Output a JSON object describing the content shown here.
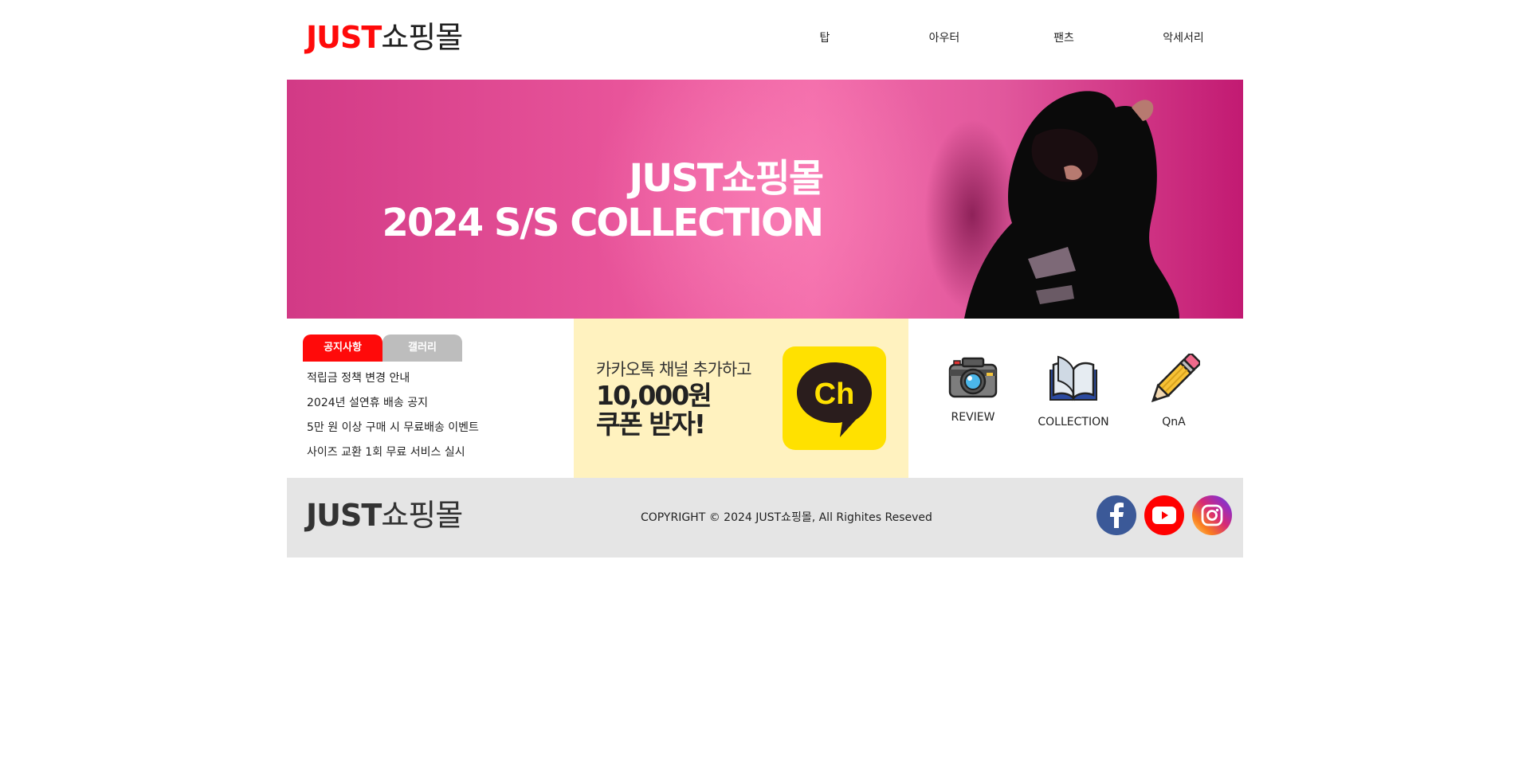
{
  "header": {
    "logo_en": "JUST",
    "logo_ko": "쇼핑몰",
    "nav": [
      "탑",
      "아우터",
      "팬츠",
      "악세서리"
    ]
  },
  "banner": {
    "title_line1": "JUST쇼핑몰",
    "title_line2": "2024 S/S COLLECTION",
    "background_color": "#e8549a"
  },
  "notice": {
    "tabs": [
      {
        "label": "공지사항",
        "active": true
      },
      {
        "label": "갤러리",
        "active": false
      }
    ],
    "items": [
      "적립금 정책 변경 안내",
      "2024년 설연휴 배송 공지",
      "5만 원 이상 구매 시 무료배송 이벤트",
      "사이즈 교환 1회 무료 서비스 실시"
    ]
  },
  "kakao": {
    "line1": "카카오톡 채널 추가하고",
    "line2": "10,000원",
    "line3": "쿠폰 받자!",
    "channel_icon_text": "Ch",
    "background_color": "#fff2bf",
    "icon_color": "#ffe100"
  },
  "quick_links": [
    {
      "label": "REVIEW",
      "icon": "camera-icon"
    },
    {
      "label": "COLLECTION",
      "icon": "book-icon"
    },
    {
      "label": "QnA",
      "icon": "pencil-icon"
    }
  ],
  "footer": {
    "logo_en": "JUST",
    "logo_ko": "쇼핑몰",
    "copyright": "COPYRIGHT © 2024 JUST쇼핑몰, All Righites Reseved",
    "social": [
      {
        "name": "facebook-icon",
        "color": "#3b5998"
      },
      {
        "name": "youtube-icon",
        "color": "#ff0000"
      },
      {
        "name": "instagram-icon",
        "color": "#d62976"
      }
    ]
  },
  "colors": {
    "accent": "#ff0a0a",
    "tab_inactive": "#bdbdbd",
    "footer_bg": "#e5e5e5"
  }
}
